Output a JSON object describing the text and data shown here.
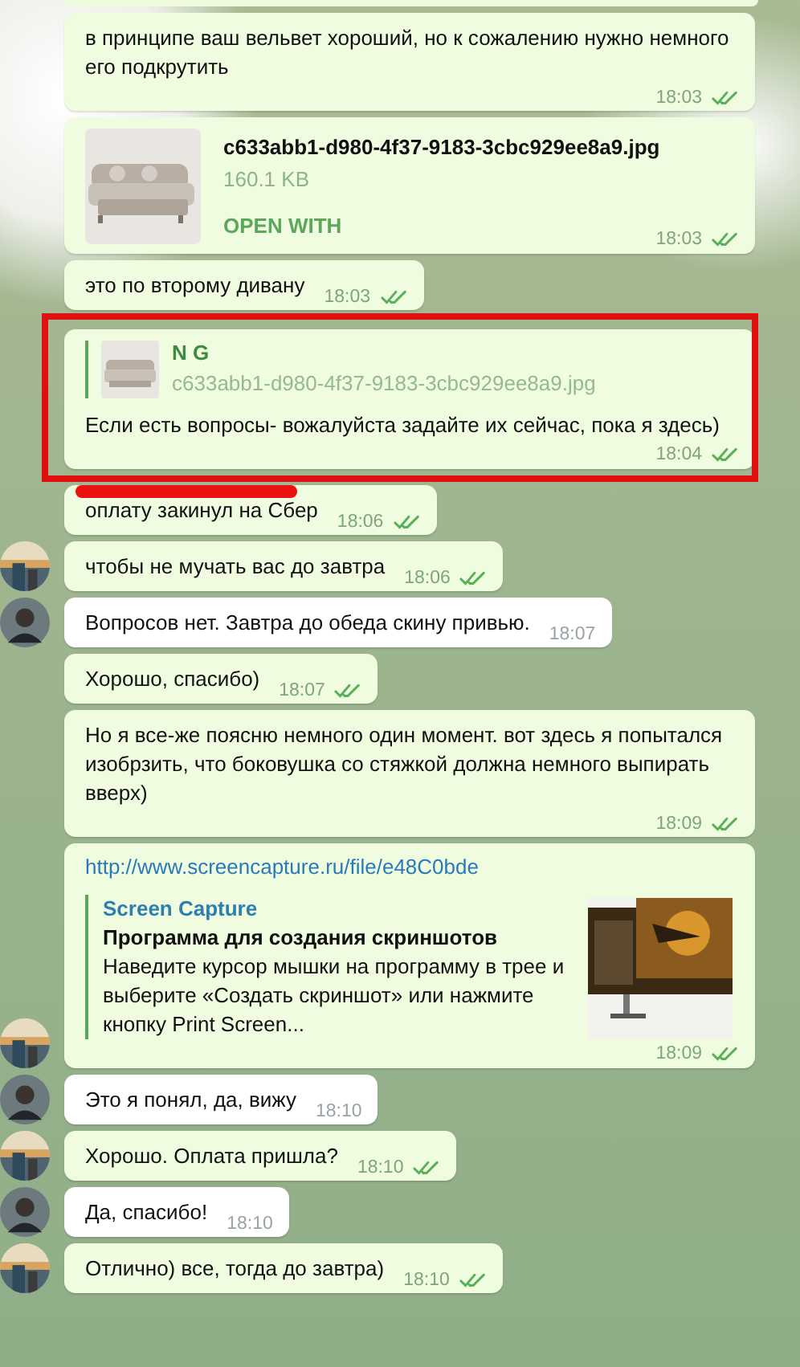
{
  "messages": [
    {
      "kind": "text",
      "outgoing": true,
      "avatar": false,
      "text": "в принципе ваш вельвет хороший, но к сожалению нужно немного его подкрутить",
      "time": "18:03",
      "read": true
    },
    {
      "kind": "file",
      "outgoing": true,
      "avatar": false,
      "file_name": "c633abb1-d980-4f37-9183-3cbc929ee8a9.jpg",
      "file_size": "160.1 KB",
      "action": "OPEN WITH",
      "time": "18:03",
      "read": true
    },
    {
      "kind": "text",
      "outgoing": true,
      "avatar": false,
      "text": "это по второму дивану",
      "time": "18:03",
      "read": true
    },
    {
      "kind": "reply",
      "outgoing": true,
      "avatar": false,
      "highlighted": true,
      "reply_author": "N G",
      "reply_file": "c633abb1-d980-4f37-9183-3cbc929ee8a9.jpg",
      "text": "Если есть вопросы- вожалуйста задайте их сейчас, пока я здесь)",
      "time": "18:04",
      "read": true
    },
    {
      "kind": "text",
      "outgoing": true,
      "avatar": false,
      "redacted": true,
      "text": "оплату закинул на Сбер",
      "time": "18:06",
      "read": true
    },
    {
      "kind": "text",
      "outgoing": true,
      "avatar": true,
      "text": "чтобы не мучать вас до завтра",
      "time": "18:06",
      "read": true
    },
    {
      "kind": "text",
      "outgoing": false,
      "avatar": true,
      "text": "Вопросов нет. Завтра до обеда скину привью.",
      "time": "18:07"
    },
    {
      "kind": "text",
      "outgoing": true,
      "avatar": false,
      "text": "Хорошо, спасибо)",
      "time": "18:07",
      "read": true
    },
    {
      "kind": "text",
      "outgoing": true,
      "avatar": false,
      "text": "Но я все-же поясню немного один момент.  вот здесь я попытался изобрзить, что боковушка со стяжкой должна немного выпирать вверх)",
      "time": "18:09",
      "read": true
    },
    {
      "kind": "link",
      "outgoing": true,
      "avatar": true,
      "url": "http://www.screencapture.ru/file/e48C0bde",
      "site": "Screen Capture",
      "title": "Программа для создания скриншотов",
      "description": "Наведите курсор мышки на программу в трее и выберите «Создать скриншот» или нажмите кнопку Print Screen...",
      "time": "18:09",
      "read": true
    },
    {
      "kind": "text",
      "outgoing": false,
      "avatar": true,
      "text": "Это я понял, да, вижу",
      "time": "18:10"
    },
    {
      "kind": "text",
      "outgoing": true,
      "avatar": true,
      "text": "Хорошо. Оплата пришла?",
      "time": "18:10",
      "read": true
    },
    {
      "kind": "text",
      "outgoing": false,
      "avatar": true,
      "text": "Да, спасибо!",
      "time": "18:10"
    },
    {
      "kind": "text",
      "outgoing": true,
      "avatar": true,
      "text": "Отлично) все, тогда до завтра)",
      "time": "18:10",
      "read": true
    }
  ]
}
